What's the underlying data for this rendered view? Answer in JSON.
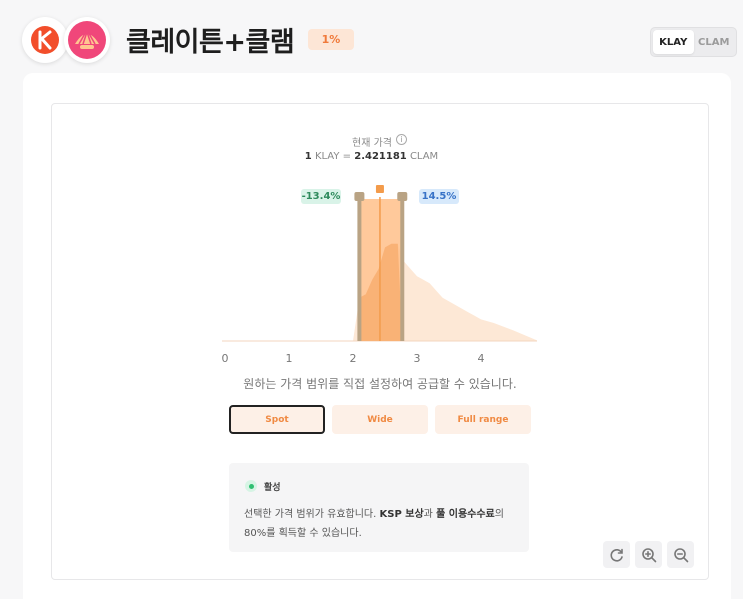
{
  "header": {
    "pair_title": "클레이튼+클램",
    "fee_badge": "1%",
    "token_a_icon": "klay-logo-icon",
    "token_b_icon": "clam-logo-icon",
    "toggle": {
      "options": [
        "KLAY",
        "CLAM"
      ],
      "selected": "KLAY"
    }
  },
  "price": {
    "label": "현재 가격",
    "base_amount": "1",
    "base_symbol": "KLAY",
    "equals": "=",
    "quote_amount": "2.421181",
    "quote_symbol": "CLAM"
  },
  "range": {
    "low_pct": "-13.4%",
    "high_pct": "14.5%"
  },
  "chart_data": {
    "type": "area",
    "x_ticks": [
      "0",
      "1",
      "2",
      "3",
      "4"
    ],
    "xlim": [
      0,
      4.9
    ],
    "current_price": 2.421181,
    "range_low": 2.1,
    "range_high": 2.77,
    "liquidity_x": [
      0.0,
      2.0,
      2.1,
      2.2,
      2.3,
      2.4,
      2.5,
      2.6,
      2.7,
      2.8,
      2.9,
      3.0,
      3.1,
      3.2,
      3.3,
      3.4,
      3.5,
      3.6,
      3.7,
      3.8,
      3.9,
      4.0,
      4.2,
      4.5,
      4.9
    ],
    "liquidity_y": [
      0.0,
      0.0,
      0.12,
      0.13,
      0.17,
      0.2,
      0.26,
      0.27,
      0.27,
      0.22,
      0.2,
      0.18,
      0.17,
      0.16,
      0.14,
      0.12,
      0.11,
      0.1,
      0.09,
      0.08,
      0.07,
      0.06,
      0.05,
      0.03,
      0.0
    ],
    "colors": {
      "liquidity": "#fde8d6",
      "in_range": "#ffc08a",
      "handle": "#b9a384",
      "current": "#f39b4b"
    }
  },
  "description": "원하는 가격 범위를 직접 설정하여 공급할 수 있습니다.",
  "range_buttons": [
    {
      "label": "Spot",
      "selected": true
    },
    {
      "label": "Wide",
      "selected": false
    },
    {
      "label": "Full range",
      "selected": false
    }
  ],
  "status": {
    "label": "활성",
    "text_1": "선택한 가격 범위가 유효합니다. ",
    "bold_1": "KSP 보상",
    "text_2": "과 ",
    "bold_2": "풀 이용수수료",
    "text_3": "의 80%를 획득할 수 있습니다."
  },
  "tools": [
    {
      "icon": "refresh-icon"
    },
    {
      "icon": "zoom-in-icon"
    },
    {
      "icon": "zoom-out-icon"
    }
  ],
  "accent_color": "#f08a43"
}
